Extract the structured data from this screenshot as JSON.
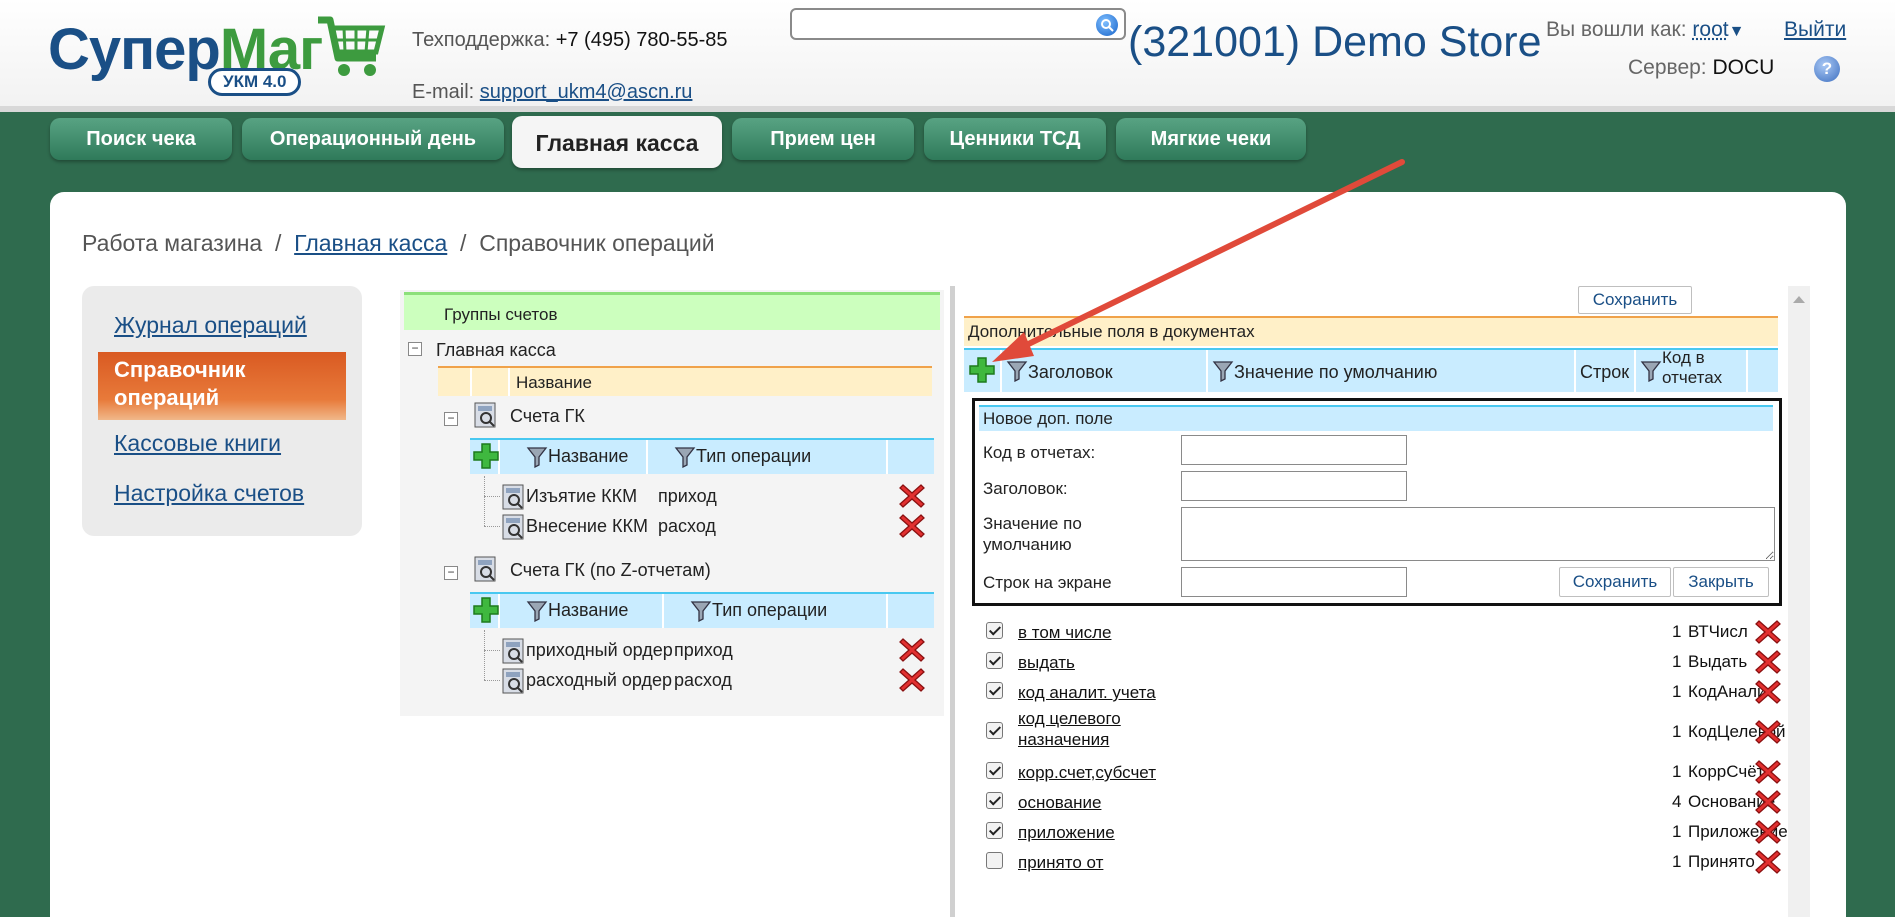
{
  "header": {
    "logo": {
      "part1": "Супер",
      "part2": "Маг",
      "badge": "УКМ 4.0"
    },
    "support_label": "Техподдержка:",
    "support_phone": "+7 (495) 780-55-85",
    "email_label": "E-mail:",
    "email": "support_ukm4@ascn.ru",
    "search": {
      "value": "",
      "placeholder": ""
    },
    "store_name": "(321001) Demo Store",
    "login_label": "Вы вошли как:",
    "login_user": "root",
    "logout": "Выйти",
    "server_label": "Сервер:",
    "server_name": "DOCU",
    "help": "?"
  },
  "tabs": [
    {
      "label": "Поиск чека"
    },
    {
      "label": "Операционный день"
    },
    {
      "label": "Главная касса",
      "active": true
    },
    {
      "label": "Прием цен"
    },
    {
      "label": "Ценники ТСД"
    },
    {
      "label": "Мягкие чеки"
    }
  ],
  "breadcrumb": {
    "root": "Работа магазина",
    "sep": "/",
    "section": "Главная касса",
    "current": "Справочник операций"
  },
  "sidenav": [
    {
      "label": "Журнал операций"
    },
    {
      "label": "Справочник операций",
      "active": true
    },
    {
      "label": "Кассовые книги"
    },
    {
      "label": "Настройка счетов"
    }
  ],
  "tree": {
    "header": "Группы счетов",
    "root": "Главная касса",
    "col_name": "Название",
    "groups": [
      {
        "name": "Счета ГК",
        "col_name": "Название",
        "col_type": "Тип операции",
        "rows": [
          {
            "name": "Изъятие ККМ",
            "type": "приход"
          },
          {
            "name": "Внесение ККМ",
            "type": "расход"
          }
        ]
      },
      {
        "name": "Счета ГК (по Z-отчетам)",
        "col_name": "Название",
        "col_type": "Тип операции",
        "rows": [
          {
            "name": "приходный ордер",
            "type": "приход"
          },
          {
            "name": "расходный ордер",
            "type": "расход"
          }
        ]
      }
    ]
  },
  "right": {
    "save_top": "Сохранить",
    "section_title": "Дополнительные поля в документах",
    "columns": {
      "title": "Заголовок",
      "default": "Значение по умолчанию",
      "rows": "Строк",
      "code": "Код в отчетах"
    },
    "form": {
      "title": "Новое доп. поле",
      "code_label": "Код в отчетах:",
      "title_label": "Заголовок:",
      "default_label": "Значение по умолчанию",
      "rows_label": "Строк на экране",
      "save": "Сохранить",
      "close": "Закрыть"
    },
    "fields": [
      {
        "checked": true,
        "title": "в том числе",
        "rows": "1",
        "code": "ВТЧисл"
      },
      {
        "checked": true,
        "title": "выдать",
        "rows": "1",
        "code": "Выдать"
      },
      {
        "checked": true,
        "title": "код аналит. учета",
        "rows": "1",
        "code": "КодАналит"
      },
      {
        "checked": true,
        "title": "код целевого назначения",
        "rows": "1",
        "code": "КодЦелевой"
      },
      {
        "checked": true,
        "title": "корр.счет,субсчет",
        "rows": "1",
        "code": "КоррСчёт"
      },
      {
        "checked": true,
        "title": "основание",
        "rows": "4",
        "code": "Основание"
      },
      {
        "checked": true,
        "title": "приложение",
        "rows": "1",
        "code": "Приложение"
      },
      {
        "checked": false,
        "title": "принято от",
        "rows": "1",
        "code": "Принято"
      }
    ]
  },
  "colors": {
    "brand_blue": "#1a4f86",
    "brand_green": "#3d9b3f",
    "bg_green": "#2f6b4e",
    "active_orange": "#d95a22",
    "arrow_red": "#e04a3a"
  }
}
